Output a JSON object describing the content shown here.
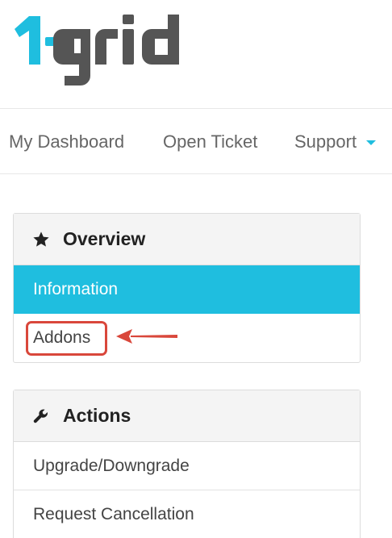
{
  "brand": {
    "logo_text": "1-grid",
    "accent_color": "#1fbedf",
    "dark_color": "#555555"
  },
  "nav": {
    "dashboard": "My Dashboard",
    "open_ticket": "Open Ticket",
    "support": "Support"
  },
  "overview_panel": {
    "title": "Overview",
    "icon": "star-icon",
    "items": [
      {
        "label": "Information",
        "active": true
      },
      {
        "label": "Addons",
        "active": false
      }
    ]
  },
  "actions_panel": {
    "title": "Actions",
    "icon": "wrench-icon",
    "items": [
      {
        "label": "Upgrade/Downgrade"
      },
      {
        "label": "Request Cancellation"
      }
    ]
  },
  "annotation": {
    "highlight_color": "#d9473b",
    "target": "Addons"
  }
}
